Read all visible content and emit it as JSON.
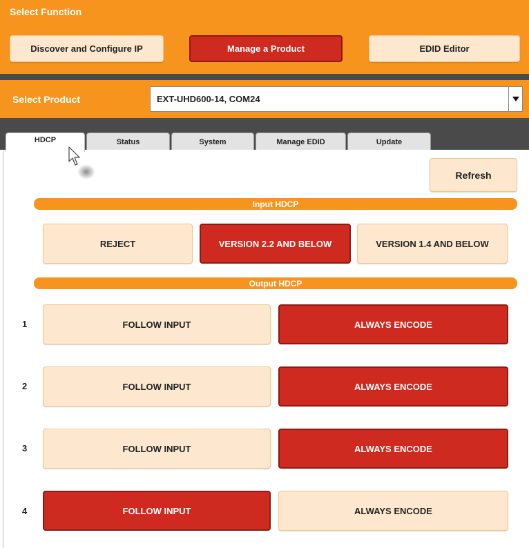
{
  "select_function": {
    "title": "Select Function",
    "buttons": [
      {
        "label": "Discover and Configure IP",
        "active": false
      },
      {
        "label": "Manage a Product",
        "active": true
      },
      {
        "label": "EDID Editor",
        "active": false
      }
    ]
  },
  "select_product": {
    "label": "Select Product",
    "selected": "EXT-UHD600-14, COM24"
  },
  "tabs": [
    {
      "label": "HDCP",
      "active": true
    },
    {
      "label": "Status",
      "active": false
    },
    {
      "label": "System",
      "active": false
    },
    {
      "label": "Manage EDID",
      "active": false
    },
    {
      "label": "Update",
      "active": false
    }
  ],
  "hdcp": {
    "refresh_label": "Refresh",
    "input_section": "Input HDCP",
    "input_options": [
      {
        "label": "REJECT",
        "selected": false
      },
      {
        "label": "VERSION 2.2 AND BELOW",
        "selected": true
      },
      {
        "label": "VERSION 1.4 AND BELOW",
        "selected": false
      }
    ],
    "output_section": "Output HDCP",
    "outputs": [
      {
        "num": "1",
        "follow_label": "FOLLOW INPUT",
        "encode_label": "ALWAYS ENCODE",
        "mode": "always_encode"
      },
      {
        "num": "2",
        "follow_label": "FOLLOW INPUT",
        "encode_label": "ALWAYS ENCODE",
        "mode": "always_encode"
      },
      {
        "num": "3",
        "follow_label": "FOLLOW INPUT",
        "encode_label": "ALWAYS ENCODE",
        "mode": "always_encode"
      },
      {
        "num": "4",
        "follow_label": "FOLLOW INPUT",
        "encode_label": "ALWAYS ENCODE",
        "mode": "follow_input"
      }
    ]
  },
  "colors": {
    "orange": "#f7941e",
    "dark_bar": "#4a4a4a",
    "selected_red": "#cf2a1f",
    "unselected_cream": "#fde8cf"
  },
  "icons": {
    "dropdown_arrow": "triangle-down",
    "cursor": "arrow-pointer"
  }
}
